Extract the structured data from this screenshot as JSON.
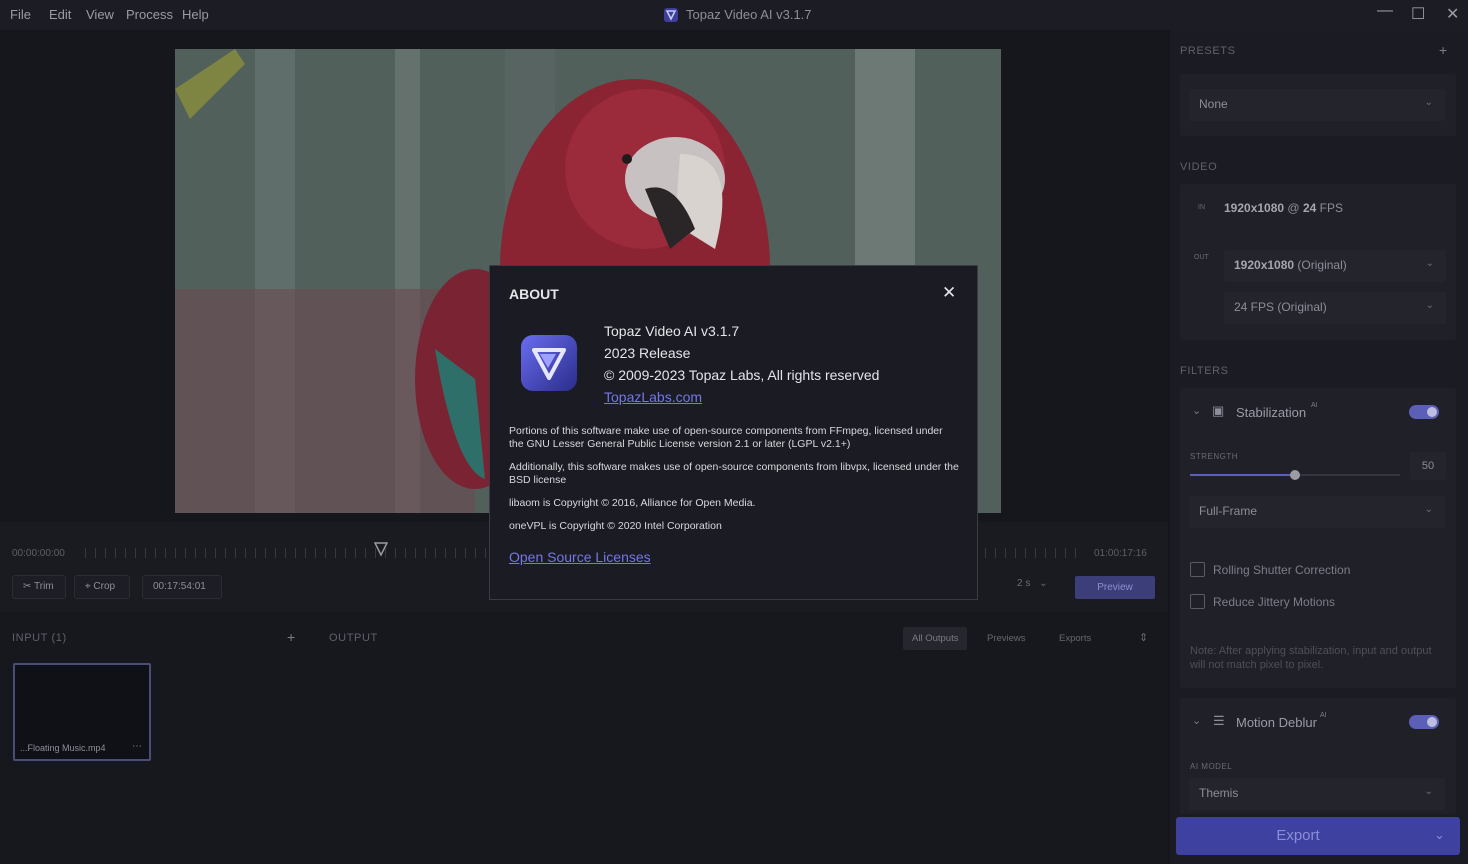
{
  "menu": {
    "file": "File",
    "edit": "Edit",
    "view": "View",
    "process": "Process",
    "help": "Help"
  },
  "app_title": "Topaz Video AI  v3.1.7",
  "timeline": {
    "start_time": "00:00:00:00",
    "end_time": "01:00:17:16",
    "trim_label": "Trim",
    "crop_label": "Crop",
    "current_time": "00:17:54:01",
    "zoom_label": "2 s",
    "preview_label": "Preview"
  },
  "input": {
    "header": "INPUT (1)",
    "file_name": "...Floating Music.mp4"
  },
  "output": {
    "header": "OUTPUT",
    "tabs": [
      "All Outputs",
      "Previews",
      "Exports"
    ]
  },
  "presets": {
    "header": "PRESETS",
    "value": "None"
  },
  "video": {
    "header": "VIDEO",
    "in_label": "IN",
    "in_resolution": "1920x1080",
    "in_at": "@",
    "in_fps": "24",
    "in_fps_unit": "FPS",
    "out_label": "OUT",
    "out_resolution": "1920x1080",
    "out_resolution_note": "(Original)",
    "out_fps": "24 FPS (Original)"
  },
  "filters": {
    "header": "FILTERS",
    "stabilization": {
      "name": "Stabilization",
      "ai_badge": "AI",
      "strength_label": "STRENGTH",
      "strength_value": "50",
      "strength_fraction": 0.5,
      "mode": "Full-Frame",
      "rolling_shutter": "Rolling Shutter Correction",
      "reduce_jittery": "Reduce Jittery Motions",
      "note": "Note: After applying stabilization, input and output will not match pixel to pixel."
    },
    "motion_deblur": {
      "name": "Motion Deblur",
      "ai_badge": "AI",
      "model_label": "AI MODEL",
      "model_value": "Themis"
    }
  },
  "export_label": "Export",
  "about": {
    "title": "ABOUT",
    "product": "Topaz Video AI  v3.1.7",
    "release": "2023 Release",
    "copyright": "© 2009-2023 Topaz Labs, All rights reserved",
    "website": "TopazLabs.com",
    "ffmpeg_note": "Portions of this software make use of open-source components from FFmpeg, licensed under the GNU Lesser General Public License version 2.1 or later (LGPL v2.1+)",
    "libvpx_note": "Additionally, this software makes use of open-source components from libvpx, licensed under the BSD license",
    "libaom_note": "libaom is Copyright © 2016, Alliance for Open Media.",
    "onevpl_note": "oneVPL is Copyright © 2020 Intel Corporation",
    "licenses_link": "Open Source Licenses"
  },
  "icons": [
    "topaz-logo-icon",
    "minimize-icon",
    "maximize-icon",
    "close-icon",
    "scissors-icon",
    "crop-icon",
    "plus-icon",
    "chevron-down-icon",
    "stabilization-icon",
    "motion-deblur-icon",
    "more-icon"
  ],
  "colors": {
    "accent": "#5b5fb8",
    "link": "#7477e6",
    "background": "#16171d",
    "modal": "#1b1c23"
  }
}
